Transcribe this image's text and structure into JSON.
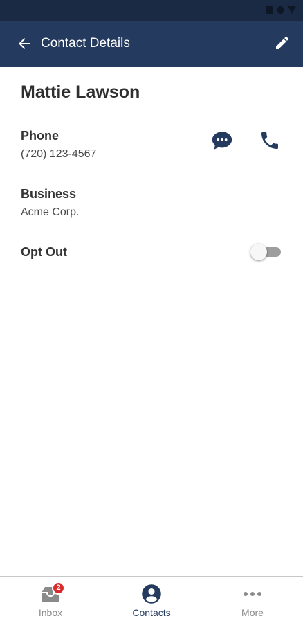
{
  "colors": {
    "status_bar": "#1b2a44",
    "app_bar": "#243a5e",
    "accent_icon": "#243a5e",
    "badge": "#d92b2b",
    "inactive_nav": "#8a8a8a"
  },
  "header": {
    "title": "Contact Details",
    "back_icon": "arrow-left-icon",
    "edit_icon": "pencil-icon"
  },
  "contact": {
    "name": "Mattie Lawson",
    "phone_label": "Phone",
    "phone_value": "(720) 123-4567",
    "business_label": "Business",
    "business_value": "Acme Corp.",
    "opt_out_label": "Opt Out",
    "opt_out_enabled": false
  },
  "actions": {
    "message_icon": "chat-bubble-icon",
    "call_icon": "phone-icon"
  },
  "bottom_nav": {
    "items": [
      {
        "label": "Inbox",
        "icon": "inbox-icon",
        "badge": "2",
        "active": false
      },
      {
        "label": "Contacts",
        "icon": "account-circle-icon",
        "active": true
      },
      {
        "label": "More",
        "icon": "more-horizontal-icon",
        "active": false
      }
    ]
  }
}
